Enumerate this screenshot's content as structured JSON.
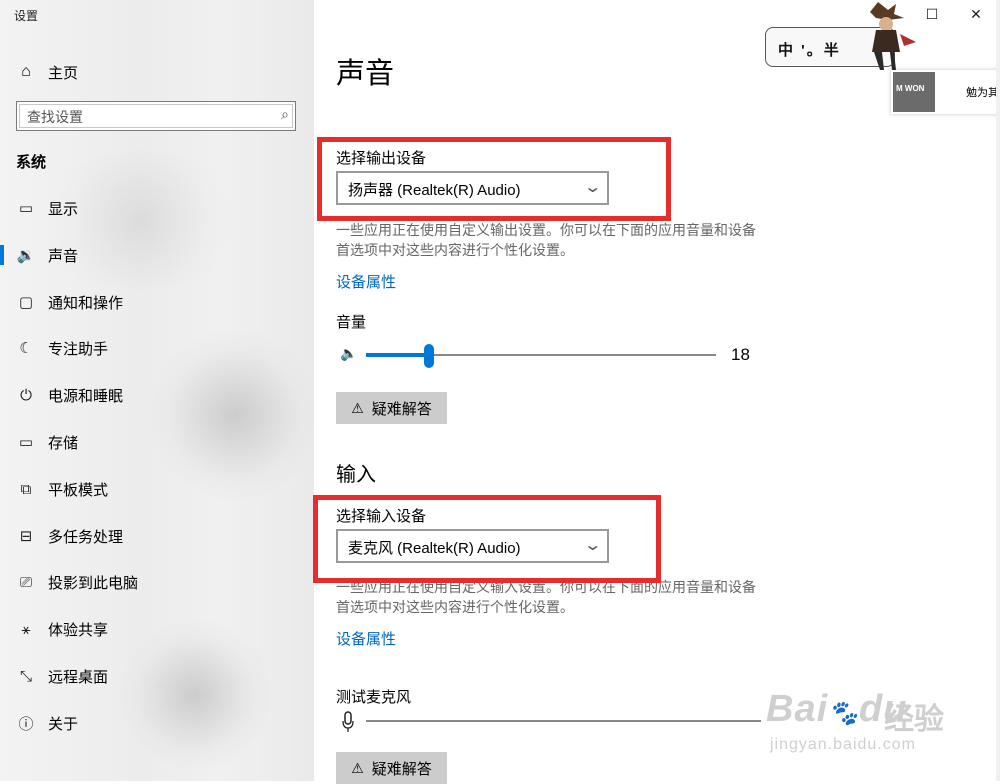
{
  "window": {
    "title": "设置",
    "minimize": "—",
    "maximize": "☐",
    "close": "✕"
  },
  "sidebar": {
    "home": {
      "label": "主页",
      "icon": "home-icon"
    },
    "search": {
      "placeholder": "查找设置",
      "icon": "search-icon"
    },
    "section": "系统",
    "items": [
      {
        "label": "显示",
        "icon": "monitor-icon",
        "glyph": "▭"
      },
      {
        "label": "声音",
        "icon": "speaker-icon",
        "glyph": "🔉",
        "active": true
      },
      {
        "label": "通知和操作",
        "icon": "notification-icon",
        "glyph": "▢"
      },
      {
        "label": "专注助手",
        "icon": "moon-icon",
        "glyph": "☾"
      },
      {
        "label": "电源和睡眠",
        "icon": "power-icon",
        "glyph": "⏻"
      },
      {
        "label": "存储",
        "icon": "storage-icon",
        "glyph": "▭"
      },
      {
        "label": "平板模式",
        "icon": "tablet-icon",
        "glyph": "⧉"
      },
      {
        "label": "多任务处理",
        "icon": "multitask-icon",
        "glyph": "⊟"
      },
      {
        "label": "投影到此电脑",
        "icon": "project-icon",
        "glyph": "⎚"
      },
      {
        "label": "体验共享",
        "icon": "share-icon",
        "glyph": "⚹"
      },
      {
        "label": "远程桌面",
        "icon": "remote-icon",
        "glyph": "⤡"
      },
      {
        "label": "关于",
        "icon": "info-icon",
        "glyph": "ⓘ"
      }
    ]
  },
  "main": {
    "title": "声音",
    "output": {
      "device_label": "选择输出设备",
      "device_value": "扬声器 (Realtek(R) Audio)",
      "description": "一些应用正在使用自定义输出设置。你可以在下面的应用音量和设备首选项中对这些内容进行个性化设置。",
      "properties_link": "设备属性",
      "volume_label": "音量",
      "volume_value": "18",
      "volume_level": 0.18,
      "troubleshoot": "疑难解答"
    },
    "input": {
      "heading": "输入",
      "device_label": "选择输入设备",
      "device_value": "麦克风 (Realtek(R) Audio)",
      "description": "一些应用正在使用自定义输入设置。你可以在下面的应用音量和设备首选项中对这些内容进行个性化设置。",
      "properties_link": "设备属性",
      "test_label": "测试麦克风",
      "troubleshoot": "疑难解答"
    }
  },
  "overlay": {
    "ime_text": "中 '。半",
    "notification_text": "勉为其",
    "notification_thumb": "M WON"
  },
  "watermark": {
    "brand": "Bai",
    "brand2": "du",
    "cn": "经验",
    "url": "jingyan.baidu.com"
  },
  "colors": {
    "accent": "#0078d7",
    "highlight_box": "#e82c2c",
    "link": "#0067c0"
  }
}
